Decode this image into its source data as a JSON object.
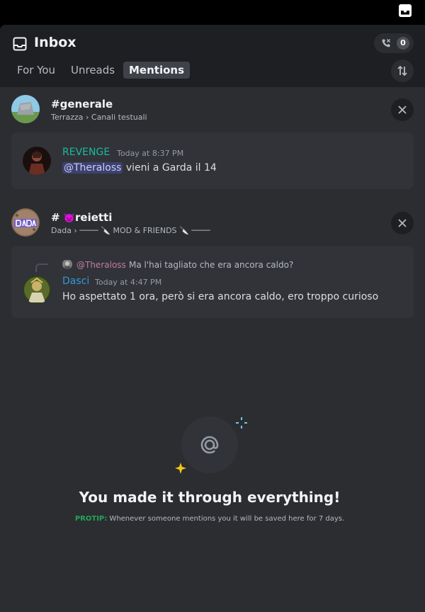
{
  "header": {
    "title": "Inbox",
    "call_count": "0",
    "tabs": [
      {
        "label": "For You"
      },
      {
        "label": "Unreads"
      },
      {
        "label": "Mentions",
        "selected": true
      }
    ]
  },
  "groups": [
    {
      "channel_hash": "#",
      "channel_name": "generale",
      "breadcrumb": "Terrazza › Canali testuali",
      "messages": [
        {
          "author": "REVENGE",
          "author_color": "#1abc9c",
          "timestamp": "Today at 8:37 PM",
          "mention": "@Theraloss",
          "text": " vieni a Garda il 14"
        }
      ]
    },
    {
      "channel_hash": "#",
      "channel_emoji": "👿",
      "channel_name": "reietti",
      "breadcrumb": "Dada › ──── 🔪 MOD & FRIENDS 🔪 ────",
      "messages": [
        {
          "reply_user": "@Theraloss",
          "reply_text": "Ma l'hai tagliato che era ancora caldo?",
          "author": "Dasci",
          "author_color": "#3498db",
          "timestamp": "Today at 4:47 PM",
          "text": "Ho aspettato 1 ora, però si era ancora caldo, ero troppo curioso"
        }
      ]
    }
  ],
  "empty_state": {
    "title": "You made it through everything!",
    "protip_label": "PROTIP:",
    "protip_text": " Whenever someone mentions you it will be saved here for 7 days."
  },
  "icons": {
    "top": "inbox-icon",
    "header": "inbox-icon",
    "call": "phone-icon",
    "sort": "sort-icon",
    "close": "close-icon",
    "empty": "at-icon"
  },
  "colors": {
    "background": "#2b2d31",
    "header_bg": "#1e1f22",
    "card_bg": "#313338",
    "protip": "#23a55a",
    "mention_bg": "#3c4270"
  }
}
